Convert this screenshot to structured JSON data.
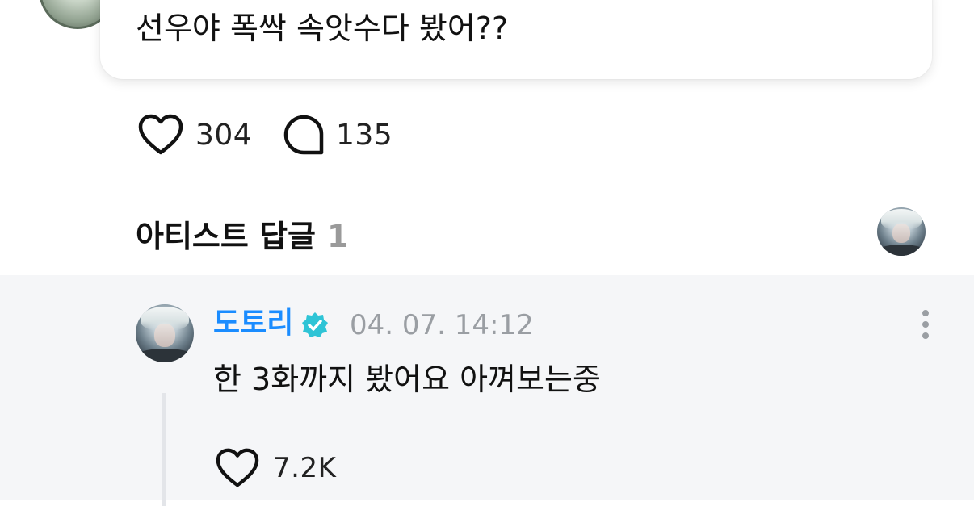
{
  "post": {
    "text": "선우야 폭싹 속앗수다 봤어??",
    "like_count": "304",
    "comment_count": "135"
  },
  "artist_replies": {
    "title": "아티스트 답글",
    "count": "1"
  },
  "reply": {
    "author": "도토리",
    "timestamp": "04. 07. 14:12",
    "text": "한 3화까지 봤어요 아껴보는중",
    "like_count": "7.2K"
  },
  "icons": {
    "like": "heart-icon",
    "comment": "comment-bubble-icon",
    "verified": "verified-badge-icon",
    "more": "more-vertical-icon"
  },
  "colors": {
    "author_name": "#1a8cff",
    "verified_badge": "#2ec4d6",
    "reply_background": "#f5f6f8",
    "muted_text": "#9a9ea3"
  }
}
